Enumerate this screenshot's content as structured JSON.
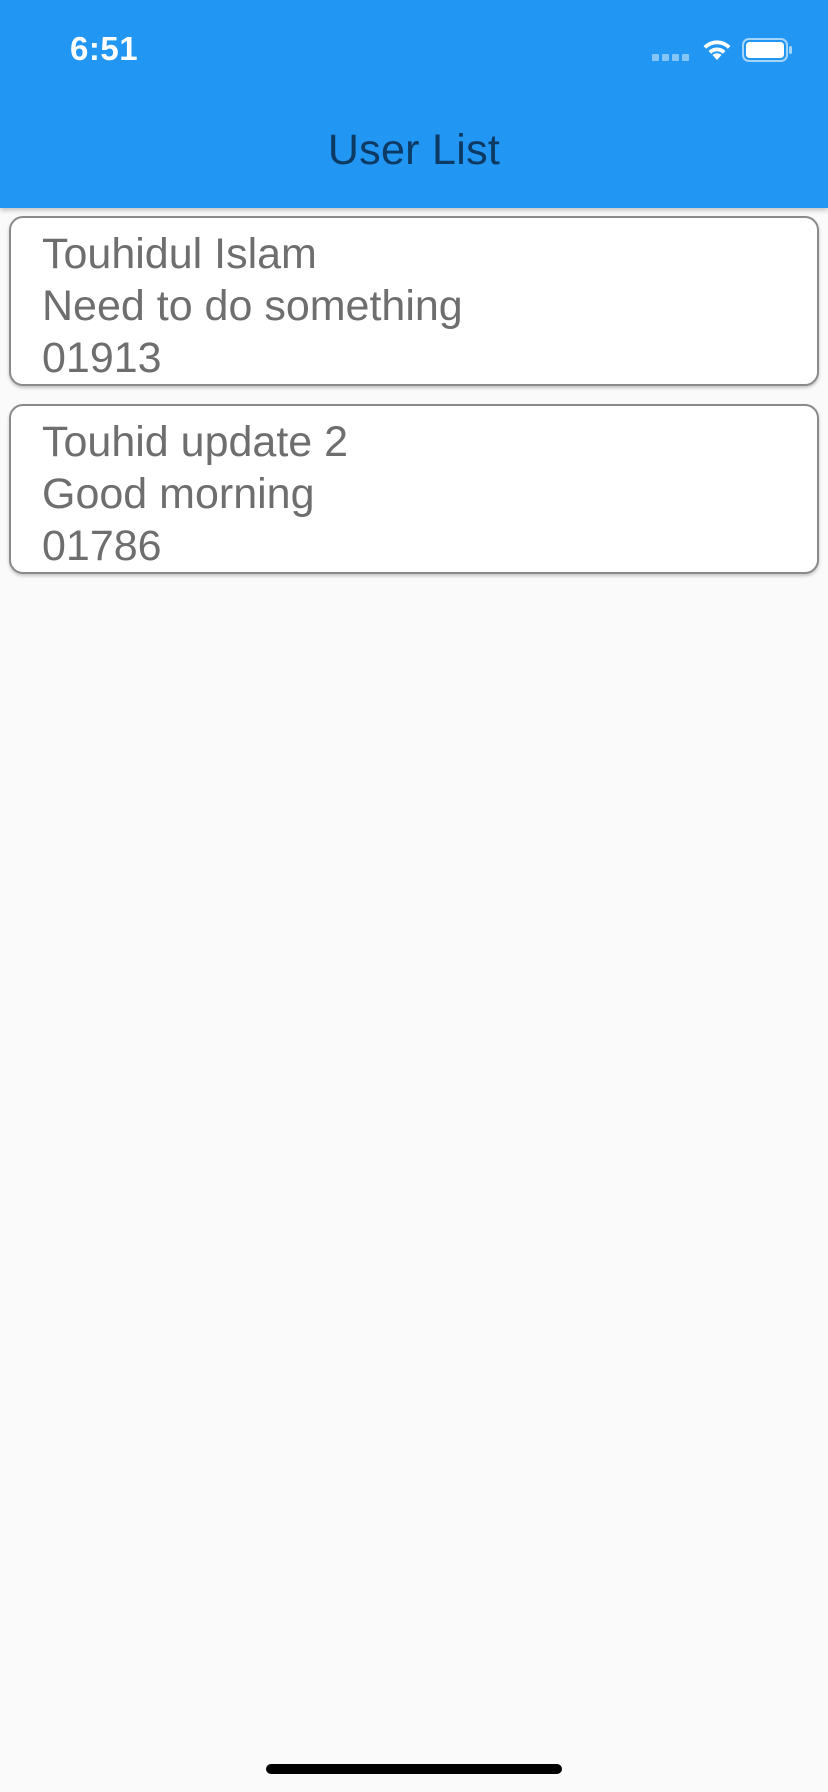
{
  "status_bar": {
    "time": "6:51"
  },
  "app_bar": {
    "title": "User List",
    "background_color": "#2196f3"
  },
  "users": [
    {
      "name": "Touhidul Islam",
      "note": "Need to do something",
      "phone": "01913"
    },
    {
      "name": "Touhid update 2",
      "note": "Good morning",
      "phone": "01786"
    }
  ]
}
